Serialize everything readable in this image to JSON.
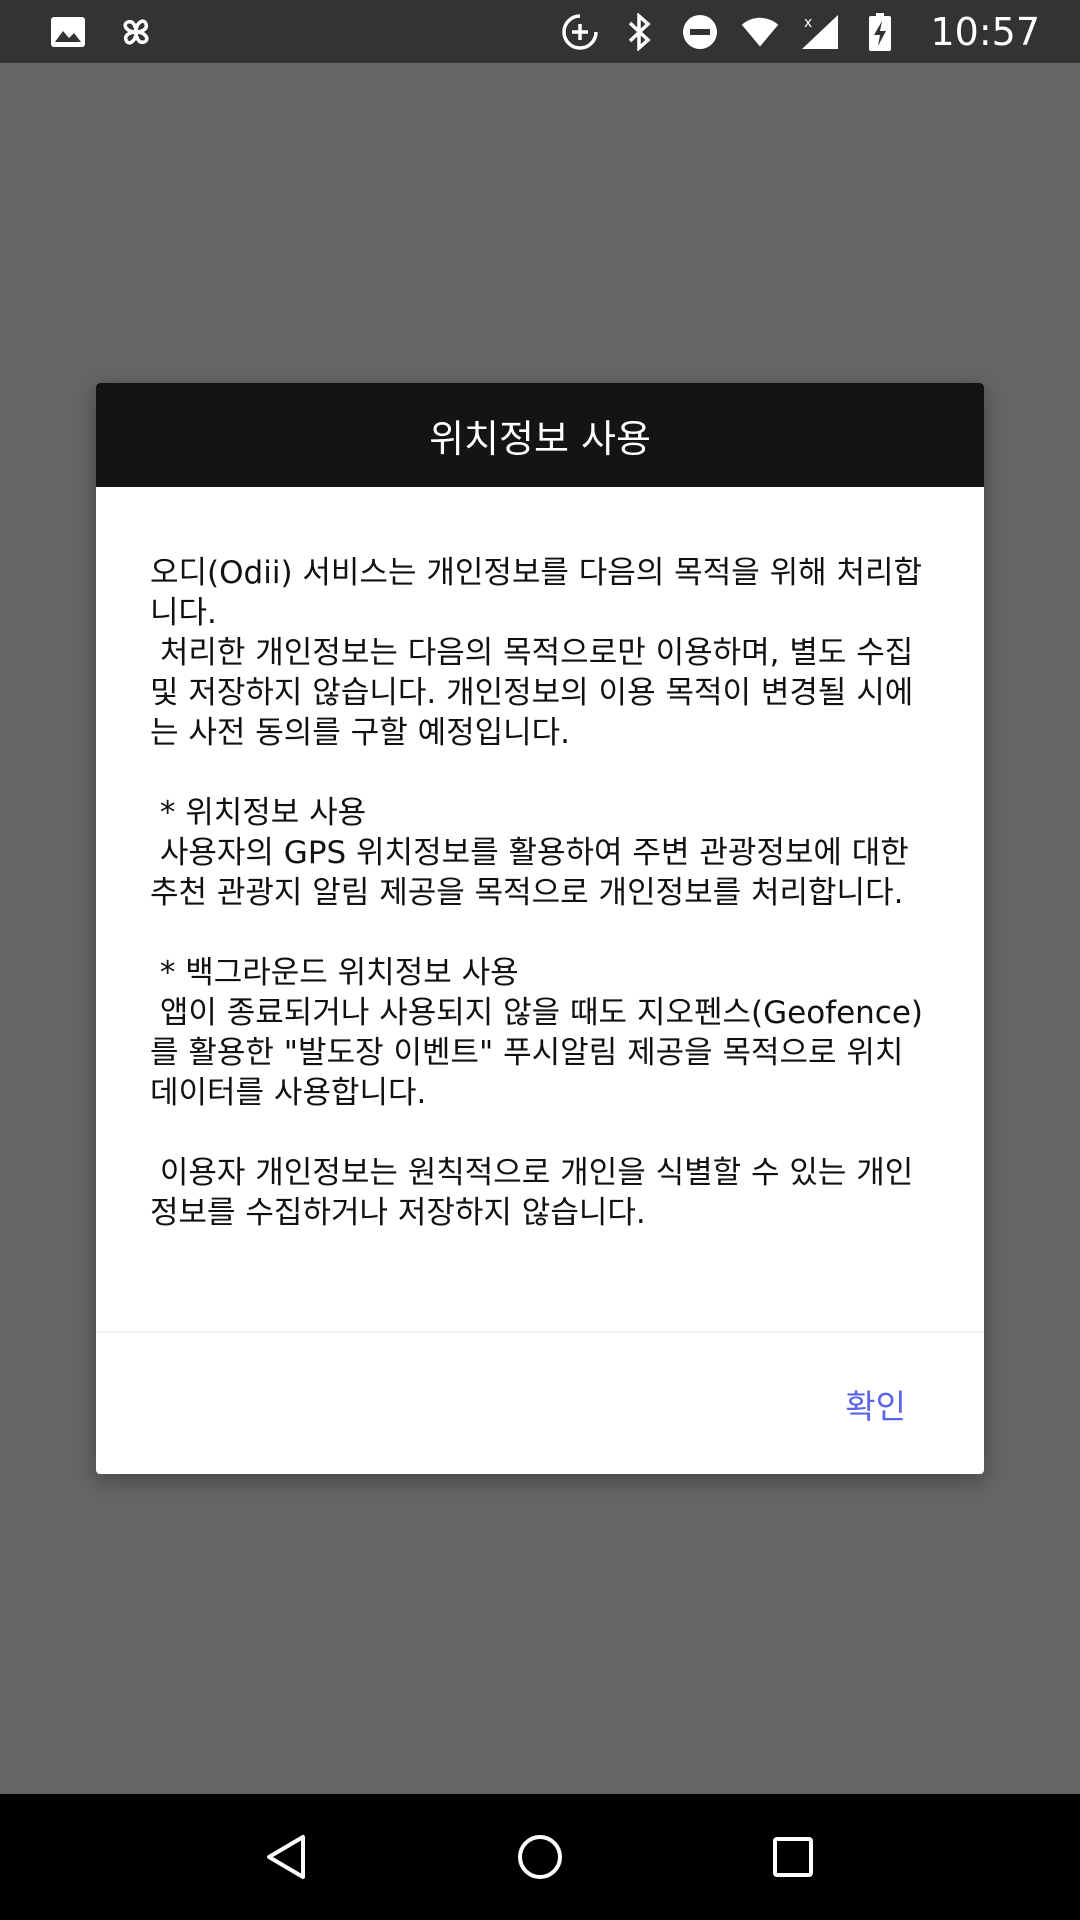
{
  "status_bar": {
    "time": "10:57",
    "left_icons": [
      "image-icon",
      "pinwheel-icon"
    ],
    "right_icons": [
      "data-saver-icon",
      "bluetooth-icon",
      "do-not-disturb-icon",
      "wifi-icon",
      "signal-icon",
      "battery-charging-icon"
    ]
  },
  "dialog": {
    "title": "위치정보 사용",
    "paragraphs": [
      "오디(Odii) 서비스는 개인정보를 다음의 목적을 위해 처리합니다.\n 처리한 개인정보는 다음의 목적으로만 이용하며, 별도 수집 및 저장하지 않습니다. 개인정보의 이용 목적이 변경될 시에는 사전 동의를 구할 예정입니다.",
      " * 위치정보 사용\n 사용자의 GPS 위치정보를 활용하여 주변 관광정보에 대한 추천 관광지 알림 제공을 목적으로 개인정보를 처리합니다.",
      " * 백그라운드 위치정보 사용\n 앱이 종료되거나 사용되지 않을 때도 지오펜스(Geofence)를 활용한 \"발도장 이벤트\" 푸시알림 제공을 목적으로 위치 데이터를 사용합니다.",
      " 이용자 개인정보는 원칙적으로 개인을 식별할 수 있는 개인정보를 수집하거나 저장하지 않습니다."
    ],
    "confirm_label": "확인"
  },
  "colors": {
    "accent": "#5b63e8",
    "header_bg": "#141414",
    "scrim": "#666666"
  },
  "nav_bar": {
    "buttons": [
      "back-icon",
      "home-icon",
      "recents-icon"
    ]
  }
}
